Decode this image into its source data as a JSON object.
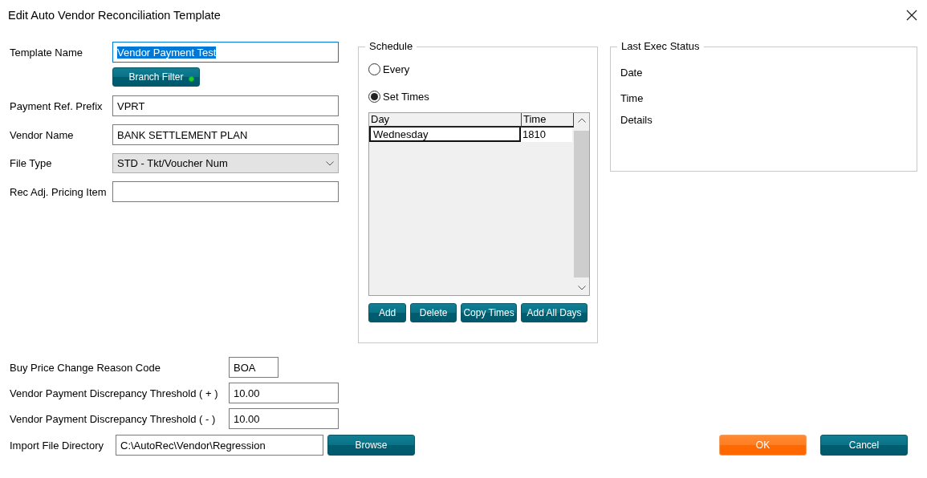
{
  "window": {
    "title": "Edit Auto Vendor Reconciliation Template"
  },
  "form": {
    "fields": [
      {
        "label": "Template Name",
        "value": "Vendor Payment Test",
        "kind": "text",
        "focused": true
      },
      {
        "label": "Payment Ref. Prefix",
        "value": "VPRT",
        "kind": "text",
        "focused": false
      },
      {
        "label": "Vendor Name",
        "value": "BANK SETTLEMENT PLAN",
        "kind": "text",
        "focused": false
      },
      {
        "label": "File Type",
        "value": "STD - Tkt/Voucher Num",
        "kind": "dropdown",
        "focused": false
      },
      {
        "label": "Rec Adj. Pricing Item",
        "kind": "text",
        "focused": false
      }
    ],
    "branch_filter": {
      "label": "Branch Filter",
      "on": true
    }
  },
  "schedule": {
    "title": "Schedule",
    "options": [
      {
        "label": "Every",
        "selected": false
      },
      {
        "label": "Set Times",
        "selected": true
      }
    ],
    "table": {
      "columns": [
        "Day",
        "Time"
      ],
      "rows": [
        [
          "Wednesday",
          "1810"
        ]
      ]
    },
    "buttons": [
      "Add",
      "Delete",
      "Copy Times",
      "Add All Days"
    ]
  },
  "last_exec_status": {
    "title": "Last Exec Status",
    "rows": [
      "Date",
      "Time",
      "Details"
    ]
  },
  "settings": [
    {
      "label": "Buy Price Change Reason Code",
      "value": "BOA",
      "kind": "code"
    },
    {
      "label": "Vendor Payment Discrepancy Threshold ( + )",
      "value": "10.00",
      "kind": "number"
    },
    {
      "label": "Vendor Payment Discrepancy Threshold ( - )",
      "value": "10.00",
      "kind": "number"
    }
  ],
  "import_directory": {
    "label": "Import File Directory",
    "value": "C:\\AutoRec\\Vendor\\Regression",
    "button": "Browse"
  },
  "actions": [
    {
      "label": "OK",
      "kind": "primary"
    },
    {
      "label": "Cancel",
      "kind": "secondary"
    }
  ]
}
